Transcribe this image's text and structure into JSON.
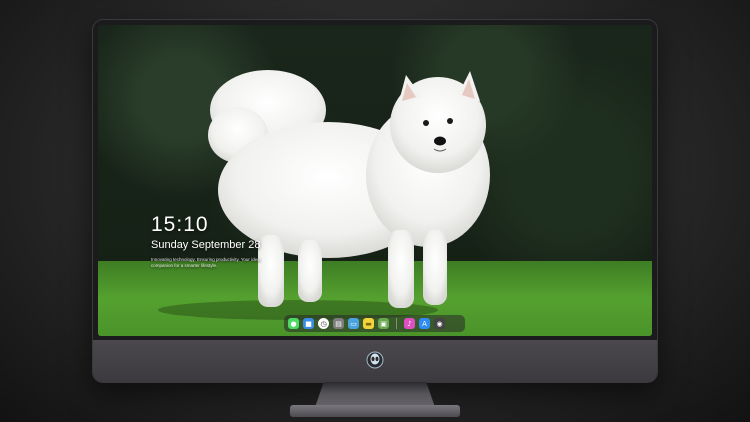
{
  "lock_screen": {
    "time": "15:10",
    "date": "Sunday September 28",
    "tagline": "Innovating technology. Ensuring productivity. Your ideal companion for a smarter lifestyle."
  },
  "wallpaper": {
    "subject": "white-samoyed-dog",
    "colors": {
      "hedge": "#1a261b",
      "grass": "#55a12f",
      "fur": "#f4f4f2"
    }
  },
  "dock": {
    "icons": [
      {
        "name": "messages-icon",
        "color": "#4cd964",
        "glyph": "●"
      },
      {
        "name": "finder-icon",
        "color": "#3a8ee6",
        "glyph": "■"
      },
      {
        "name": "clock-app-icon",
        "color": "#ffffff",
        "glyph": "◷"
      },
      {
        "name": "media-icon",
        "color": "#7d7d7d",
        "glyph": "▤"
      },
      {
        "name": "files-icon",
        "color": "#4aa3df",
        "glyph": "▭"
      },
      {
        "name": "notes-icon",
        "color": "#f5d33a",
        "glyph": "▬"
      },
      {
        "name": "photos-icon",
        "color": "#6aa84f",
        "glyph": "▣"
      },
      {
        "name": "music-icon",
        "color": "#e04fbf",
        "glyph": "♪"
      },
      {
        "name": "app-store-icon",
        "color": "#2f8cf0",
        "glyph": "A"
      },
      {
        "name": "camera-icon",
        "color": "#444444",
        "glyph": "◉"
      }
    ]
  },
  "monitor": {
    "logo": "alien-logo-icon",
    "bezel_color": "#1b1b1d",
    "chin_color": "#4a484c"
  }
}
